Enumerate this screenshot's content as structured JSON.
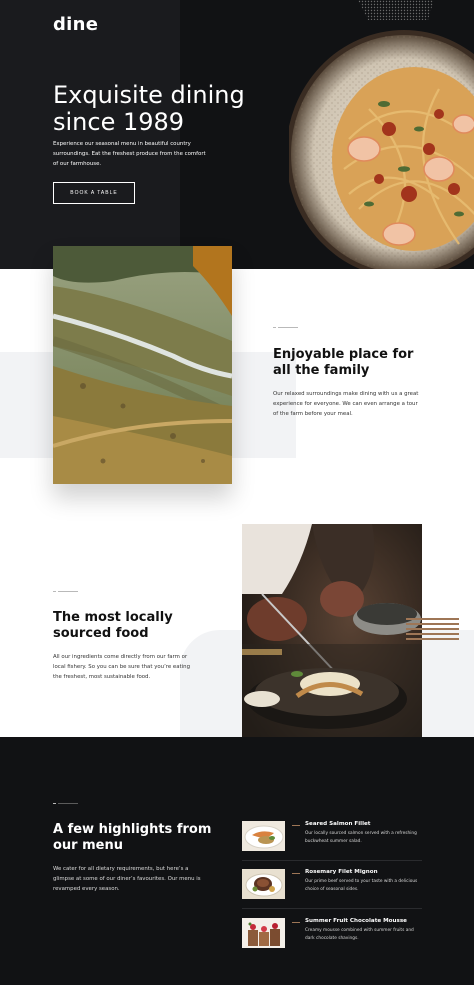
{
  "header": {
    "logo": "dine"
  },
  "hero": {
    "title": "Exquisite dining since 1989",
    "description": "Experience our seasonal menu in beautiful country surroundings. Eat the freshest produce from the comfort of our farmhouse.",
    "cta_label": "BOOK A TABLE"
  },
  "features": [
    {
      "title": "Enjoyable place for all the family",
      "description": "Our relaxed surroundings make dining with us a great experience for everyone. We can even arrange a tour of the farm before your meal."
    },
    {
      "title": "The most locally sourced food",
      "description": "All our ingredients come directly from our farm or local fishery. So you can be sure that you’re eating the freshest, most sustainable food."
    }
  ],
  "highlights": {
    "title": "A few highlights from our menu",
    "description": "We cater for all dietary requirements, but here’s a glimpse at some of our diner’s favourites. Our menu is revamped every season.",
    "items": [
      {
        "name": "Seared Salmon Fillet",
        "description": "Our locally sourced salmon served with a refreshing buckwheat summer salad."
      },
      {
        "name": "Rosemary Filet Mignon",
        "description": "Our prime beef served to your taste with a delicious choice of seasonal sides."
      },
      {
        "name": "Summer Fruit Chocolate Mousse",
        "description": "Creamy mousse combined with summer fruits and dark chocolate shavings."
      }
    ]
  },
  "colors": {
    "dark": "#111214",
    "accent": "#9e7656",
    "light_gray": "#f2f3f5"
  }
}
